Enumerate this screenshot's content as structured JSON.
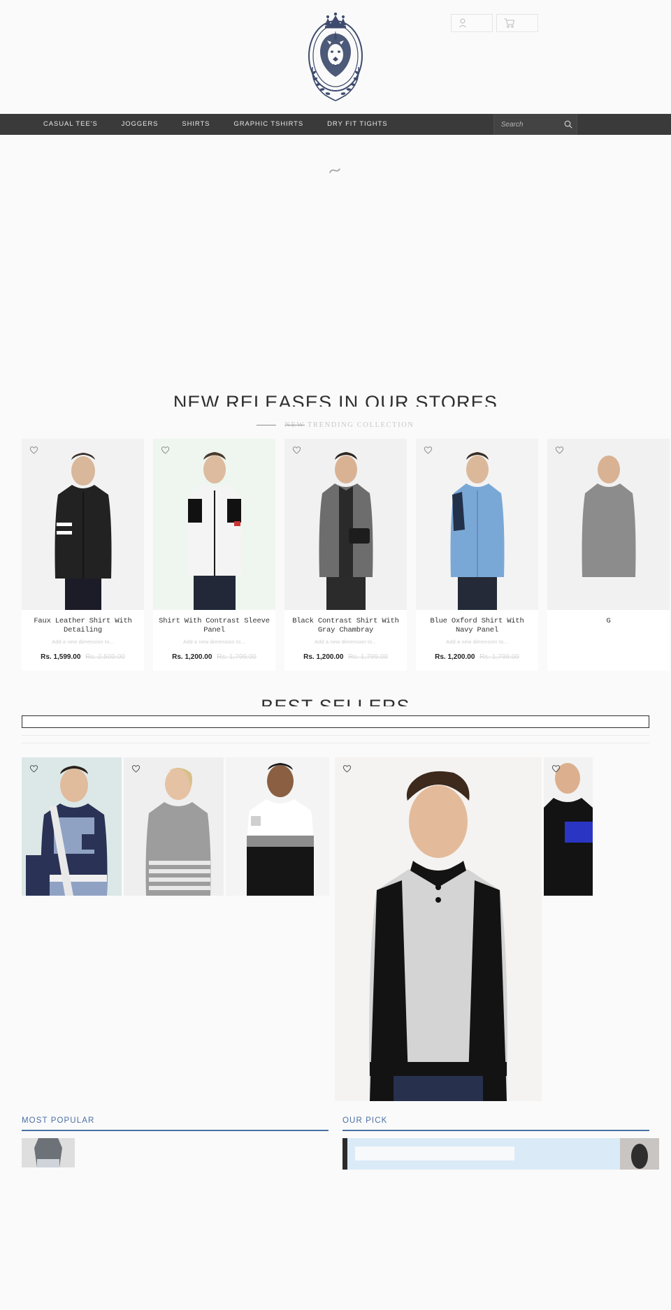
{
  "header": {
    "logo_name": "lion-crest-logo",
    "account_icon": "user-icon",
    "cart_icon": "cart-icon"
  },
  "nav": {
    "items": [
      {
        "label": "CASUAL TEE'S"
      },
      {
        "label": "JOGGERS"
      },
      {
        "label": "SHIRTS"
      },
      {
        "label": "GRAPHIC TSHIRTS"
      },
      {
        "label": "DRY FIT TIGHTS"
      }
    ],
    "search": {
      "placeholder": "Search",
      "value": "",
      "icon": "search-icon"
    }
  },
  "sections": {
    "new_releases": {
      "title": "NEW RELEASES IN OUR STORES",
      "subtitle_strike": "NEW",
      "subtitle_rest": " TRENDING COLLECTION"
    },
    "best_sellers": {
      "title": "BEST SELLERS"
    },
    "most_popular": {
      "title": "MOST POPULAR"
    },
    "our_pick": {
      "title": "OUR PICK"
    }
  },
  "products": [
    {
      "name": "Faux Leather Shirt With Detailing",
      "desc": "Add a new dimension to...",
      "price": "Rs. 1,599.00",
      "price_old": "Rs. 2,500.00",
      "wishlist_icon": "heart-icon"
    },
    {
      "name": "Shirt With Contrast Sleeve Panel",
      "desc": "Add a new dimension to...",
      "price": "Rs. 1,200.00",
      "price_old": "Rs. 1,799.00",
      "wishlist_icon": "heart-icon"
    },
    {
      "name": "Black Contrast Shirt With Gray Chambray",
      "desc": "Add a new dimension to...",
      "price": "Rs. 1,200.00",
      "price_old": "Rs. 1,799.00",
      "wishlist_icon": "heart-icon"
    },
    {
      "name": "Blue Oxford Shirt With Navy Panel",
      "desc": "Add a new dimension to...",
      "price": "Rs. 1,200.00",
      "price_old": "Rs. 1,799.00",
      "wishlist_icon": "heart-icon"
    },
    {
      "name": "G",
      "desc": "",
      "price": "",
      "price_old": "",
      "wishlist_icon": "heart-icon"
    }
  ],
  "colors": {
    "nav_bg": "#3a3a3a",
    "page_bg": "#fafafa",
    "accent_blue": "#4a6fa5",
    "logo_navy": "#3d4b6e",
    "price_old": "#d8d8d8",
    "pick_panel": "#daeaf7"
  }
}
